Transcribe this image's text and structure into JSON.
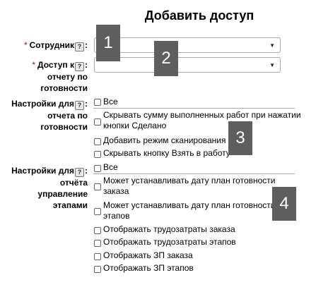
{
  "title": "Добавить доступ",
  "required_mark": "*",
  "help_icon": "?",
  "colon": ":",
  "fields": {
    "employee_label": "Сотрудник",
    "report_access_label_1": "Доступ к",
    "report_access_label_2": "отчету по",
    "report_access_label_3": "готовности",
    "report_settings_label_1": "Настройки для",
    "report_settings_label_2": "отчета по",
    "report_settings_label_3": "готовности",
    "stage_settings_label_1": "Настройки для",
    "stage_settings_label_2": "отчёта",
    "stage_settings_label_3": "управление",
    "stage_settings_label_4": "этапами"
  },
  "report_options": [
    "Все",
    "Скрывать сумму выполненных работ при нажатии",
    "кнопки Сделано",
    "Добавить режим сканирования",
    "Скрывать кнопку Взять в работу"
  ],
  "stage_options": [
    "Все",
    "Может устанавливать дату план готовности",
    "заказа",
    "Может устанавливать дату план готовности",
    "этапов",
    "Отображать трудозатраты заказа",
    "Отображать трудозатраты этапов",
    "Отображать ЗП заказа",
    "Отображать ЗП этапов"
  ],
  "markers": [
    "1",
    "2",
    "3",
    "4"
  ]
}
